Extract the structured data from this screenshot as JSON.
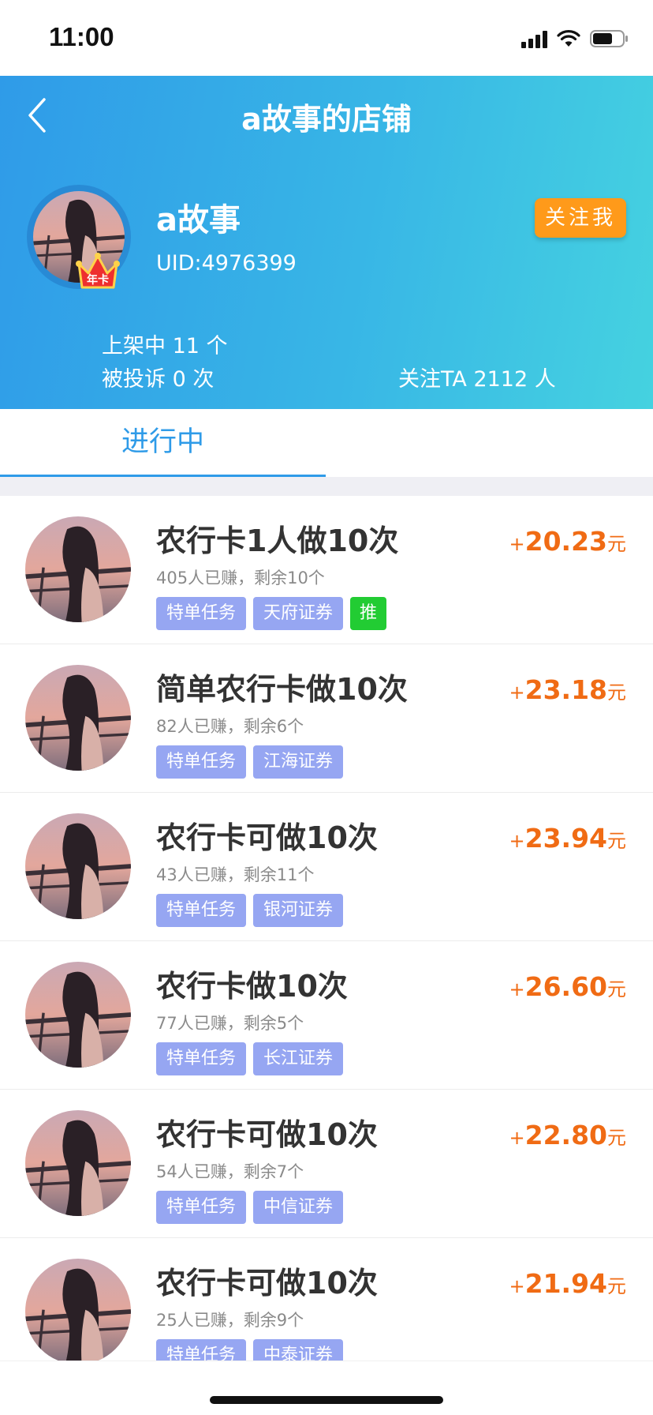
{
  "status_bar": {
    "time": "11:00"
  },
  "header": {
    "title": "a故事的店铺",
    "shop_name": "a故事",
    "uid": "UID:4976399",
    "badge_text": "年卡",
    "follow_label": "关注我",
    "stats": {
      "listed": "上架中 11 个",
      "complaints": "被投诉 0 次",
      "followers": "关注TA 2112 人"
    }
  },
  "tabs": [
    {
      "label": "进行中",
      "active": true
    }
  ],
  "tasks": [
    {
      "title": "农行卡1人做10次",
      "meta": "405人已赚，剩余10个",
      "tags": [
        "特单任务",
        "天府证券"
      ],
      "push": "推",
      "plus": "+",
      "amount": "20.23",
      "unit": "元"
    },
    {
      "title": "简单农行卡做10次",
      "meta": "82人已赚，剩余6个",
      "tags": [
        "特单任务",
        "江海证券"
      ],
      "plus": "+",
      "amount": "23.18",
      "unit": "元"
    },
    {
      "title": "农行卡可做10次",
      "meta": "43人已赚，剩余11个",
      "tags": [
        "特单任务",
        "银河证券"
      ],
      "plus": "+",
      "amount": "23.94",
      "unit": "元"
    },
    {
      "title": "农行卡做10次",
      "meta": "77人已赚，剩余5个",
      "tags": [
        "特单任务",
        "长江证券"
      ],
      "plus": "+",
      "amount": "26.60",
      "unit": "元"
    },
    {
      "title": "农行卡可做10次",
      "meta": "54人已赚，剩余7个",
      "tags": [
        "特单任务",
        "中信证券"
      ],
      "plus": "+",
      "amount": "22.80",
      "unit": "元"
    },
    {
      "title": "农行卡可做10次",
      "meta": "25人已赚，剩余9个",
      "tags": [
        "特单任务",
        "中泰证券"
      ],
      "plus": "+",
      "amount": "21.94",
      "unit": "元"
    }
  ],
  "colors": {
    "header_gradient_start": "#2f9be8",
    "header_gradient_end": "#45d2e0",
    "accent_blue": "#2f9be8",
    "reward_orange": "#f06b14",
    "follow_button": "#ff9a1a",
    "tag_bg": "#96a6f2",
    "push_tag_bg": "#22cc33"
  },
  "icons": [
    "signal-icon",
    "wifi-icon",
    "battery-icon",
    "back-icon",
    "crown-icon"
  ]
}
